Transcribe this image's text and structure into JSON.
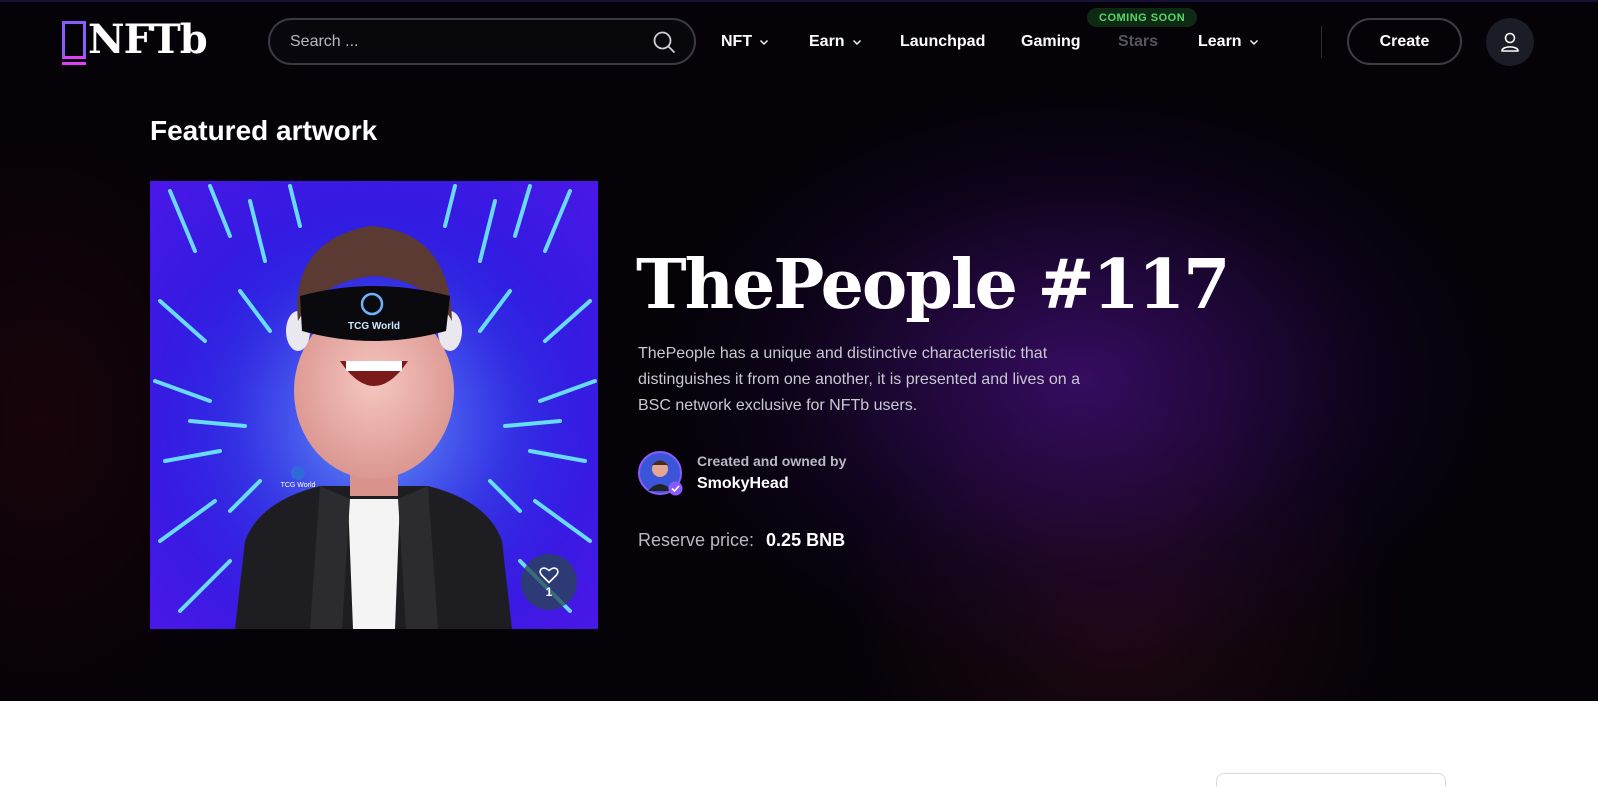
{
  "header": {
    "logo_text": "NFTb",
    "search_placeholder": "Search ...",
    "nav": [
      {
        "label": "NFT",
        "dropdown": true
      },
      {
        "label": "Earn",
        "dropdown": true
      },
      {
        "label": "Launchpad",
        "dropdown": false
      },
      {
        "label": "Gaming",
        "dropdown": false
      },
      {
        "label": "Stars",
        "dropdown": false,
        "disabled": true
      },
      {
        "label": "Learn",
        "dropdown": true
      }
    ],
    "stars_badge": "COMING SOON",
    "create_label": "Create",
    "icons": {
      "search": "search-icon",
      "chevron": "chevron-down-icon",
      "user": "user-icon"
    }
  },
  "featured": {
    "section_title": "Featured artwork",
    "nft_title": "ThePeople #117",
    "description": "ThePeople has a unique and distinctive characteristic that distinguishes it from one another, it is presented and lives on a BSC network exclusive for NFTb users.",
    "owner_label": "Created and owned by",
    "owner_name": "SmokyHead",
    "price_label": "Reserve price:",
    "price_value": "0.25 BNB",
    "likes": "1",
    "artwork_text": {
      "visor": "TCG World",
      "patch": "TCG World"
    },
    "icons": {
      "like": "heart-icon",
      "verified": "verified-check-icon"
    }
  },
  "colors": {
    "hero_bg": "#050208",
    "accent_purple": "#8a5cff",
    "badge_green": "#55d86a",
    "artwork_blue": "#2a1ae0"
  }
}
